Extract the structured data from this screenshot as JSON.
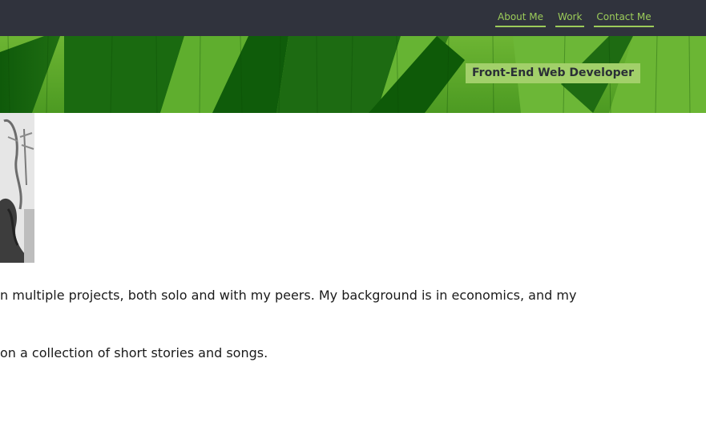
{
  "nav": {
    "items": [
      {
        "label": "About Me"
      },
      {
        "label": "Work"
      },
      {
        "label": "Contact Me"
      }
    ]
  },
  "hero": {
    "tagline": "Front-End Web Developer"
  },
  "about": {
    "paragraph_1_visible": "n multiple projects, both solo and with my peers. My background is in economics, and my",
    "paragraph_2_visible": "on a collection of short stories and songs."
  },
  "colors": {
    "topbar": "#30333d",
    "accent": "#9ccc5a",
    "tagline_bg": "#a2d06a",
    "hero_green": "#4f9a22"
  },
  "icons": {
    "portrait": "portrait-photo"
  }
}
